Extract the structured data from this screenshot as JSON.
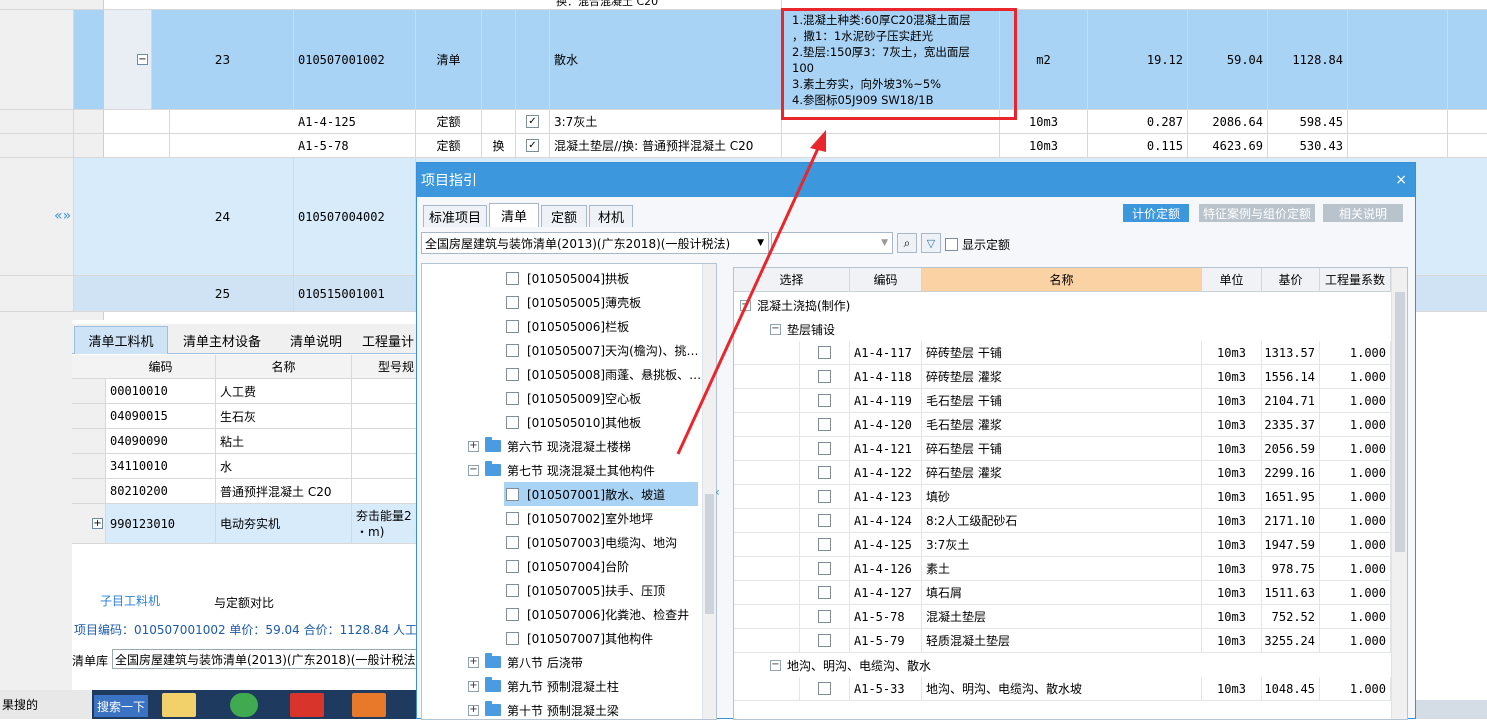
{
  "main_grid": {
    "top_partial_text": "换：混合混凝土 C20",
    "rows": [
      {
        "no": "23",
        "code": "010507001002",
        "type": "清单",
        "name": "散水",
        "features": [
          "1.混凝土种类:60厚C20混凝土面层",
          "，撒1：1水泥砂子压实赶光",
          "2.垫层:150厚3：7灰土，宽出面层",
          "100",
          "3.素土夯实，向外坡3%~5%",
          "4.参图标05J909 SW18/1B"
        ],
        "unit": "m2",
        "qty": "19.12",
        "price": "59.04",
        "total": "1128.84",
        "toggle": "−"
      },
      {
        "code": "A1-4-125",
        "type": "定额",
        "swap": "",
        "name": "3:7灰土",
        "unit": "10m3",
        "qty": "0.287",
        "price": "2086.64",
        "total": "598.45"
      },
      {
        "code": "A1-5-78",
        "type": "定额",
        "swap": "换",
        "name": "混凝土垫层//换: 普通预拌混凝土 C20",
        "unit": "10m3",
        "qty": "0.115",
        "price": "4623.69",
        "total": "530.43"
      },
      {
        "no": "24",
        "code": "010507004002"
      },
      {
        "no": "25",
        "code": "010515001001"
      }
    ]
  },
  "bottom_tabs": [
    "清单工料机",
    "清单主材设备",
    "清单说明",
    "工程量计"
  ],
  "material_grid": {
    "headers": [
      "编码",
      "名称",
      "型号规"
    ],
    "rows": [
      {
        "code": "00010010",
        "name": "人工费",
        "spec": ""
      },
      {
        "code": "04090015",
        "name": "生石灰",
        "spec": ""
      },
      {
        "code": "04090090",
        "name": "粘土",
        "spec": ""
      },
      {
        "code": "34110010",
        "name": "水",
        "spec": ""
      },
      {
        "code": "80210200",
        "name": "普通预拌混凝土 C20",
        "spec": ""
      },
      {
        "code": "990123010",
        "name": "电动夯实机",
        "spec": "夯击能量2",
        "spec2": "・m)"
      }
    ]
  },
  "sub_tabs": {
    "a": "子目工料机",
    "b": "与定额对比"
  },
  "info_line": "项目编码：010507001002  单价：59.04  合价：1128.84  人工",
  "lib_label": "清单库",
  "lib_value": "全国房屋建筑与装饰清单(2013)(广东2018)(一般计税法)",
  "taskbar": {
    "left_text": "果搜的",
    "search": "搜索一下"
  },
  "dialog": {
    "title": "项目指引",
    "close": "×",
    "tabs": [
      "标准项目",
      "清单",
      "定额",
      "材机"
    ],
    "right_buttons": [
      "计价定额",
      "特征案例与组价定额",
      "相关说明"
    ],
    "library": "全国房屋建筑与装饰清单(2013)(广东2018)(一般计税法)",
    "show_quota": "显示定额",
    "tree": [
      {
        "kind": "leaf",
        "label": "[010505004]拱板"
      },
      {
        "kind": "leaf",
        "label": "[010505005]薄壳板"
      },
      {
        "kind": "leaf",
        "label": "[010505006]栏板"
      },
      {
        "kind": "leaf",
        "label": "[010505007]天沟(檐沟)、挑…"
      },
      {
        "kind": "leaf",
        "label": "[010505008]雨蓬、悬挑板、…"
      },
      {
        "kind": "leaf",
        "label": "[010505009]空心板"
      },
      {
        "kind": "leaf",
        "label": "[010505010]其他板"
      },
      {
        "kind": "folder",
        "pm": "+",
        "label": "第六节  现浇混凝土楼梯"
      },
      {
        "kind": "folder",
        "pm": "−",
        "label": "第七节  现浇混凝土其他构件"
      },
      {
        "kind": "leaf",
        "label": "[010507001]散水、坡道",
        "selected": true
      },
      {
        "kind": "leaf",
        "label": "[010507002]室外地坪"
      },
      {
        "kind": "leaf",
        "label": "[010507003]电缆沟、地沟"
      },
      {
        "kind": "leaf",
        "label": "[010507004]台阶"
      },
      {
        "kind": "leaf",
        "label": "[010507005]扶手、压顶"
      },
      {
        "kind": "leaf",
        "label": "[010507006]化粪池、检查井"
      },
      {
        "kind": "leaf",
        "label": "[010507007]其他构件"
      },
      {
        "kind": "folder",
        "pm": "+",
        "label": "第八节  后浇带"
      },
      {
        "kind": "folder",
        "pm": "+",
        "label": "第九节  预制混凝土柱"
      },
      {
        "kind": "folder",
        "pm": "+",
        "label": "第十节  预制混凝土梁"
      }
    ],
    "list_headers": [
      "选择",
      "编码",
      "名称",
      "单位",
      "基价",
      "工程量系数"
    ],
    "groups": {
      "g1": "混凝土浇捣(制作)",
      "g2": "垫层铺设",
      "g3": "地沟、明沟、电缆沟、散水"
    },
    "list_rows": [
      {
        "code": "A1-4-117",
        "name": "碎砖垫层 干铺",
        "unit": "10m3",
        "price": "1313.57",
        "factor": "1.000"
      },
      {
        "code": "A1-4-118",
        "name": "碎砖垫层 灌浆",
        "unit": "10m3",
        "price": "1556.14",
        "factor": "1.000"
      },
      {
        "code": "A1-4-119",
        "name": "毛石垫层 干铺",
        "unit": "10m3",
        "price": "2104.71",
        "factor": "1.000"
      },
      {
        "code": "A1-4-120",
        "name": "毛石垫层 灌浆",
        "unit": "10m3",
        "price": "2335.37",
        "factor": "1.000"
      },
      {
        "code": "A1-4-121",
        "name": "碎石垫层 干铺",
        "unit": "10m3",
        "price": "2056.59",
        "factor": "1.000"
      },
      {
        "code": "A1-4-122",
        "name": "碎石垫层 灌浆",
        "unit": "10m3",
        "price": "2299.16",
        "factor": "1.000"
      },
      {
        "code": "A1-4-123",
        "name": "填砂",
        "unit": "10m3",
        "price": "1651.95",
        "factor": "1.000"
      },
      {
        "code": "A1-4-124",
        "name": "8:2人工级配砂石",
        "unit": "10m3",
        "price": "2171.10",
        "factor": "1.000"
      },
      {
        "code": "A1-4-125",
        "name": "3:7灰土",
        "unit": "10m3",
        "price": "1947.59",
        "factor": "1.000"
      },
      {
        "code": "A1-4-126",
        "name": "素土",
        "unit": "10m3",
        "price": "978.75",
        "factor": "1.000"
      },
      {
        "code": "A1-4-127",
        "name": "填石屑",
        "unit": "10m3",
        "price": "1511.63",
        "factor": "1.000"
      },
      {
        "code": "A1-5-78",
        "name": "混凝土垫层",
        "unit": "10m3",
        "price": "752.52",
        "factor": "1.000"
      },
      {
        "code": "A1-5-79",
        "name": "轻质混凝土垫层",
        "unit": "10m3",
        "price": "3255.24",
        "factor": "1.000"
      },
      {
        "code": "A1-5-33",
        "name": "地沟、明沟、电缆沟、散水坡",
        "unit": "10m3",
        "price": "1048.45",
        "factor": "1.000"
      }
    ]
  },
  "colors": {
    "selected": "#a9d3f5",
    "title_bar": "#3c97dd",
    "highlight": "#e8262b",
    "header_orange": "#fbd2a4"
  }
}
